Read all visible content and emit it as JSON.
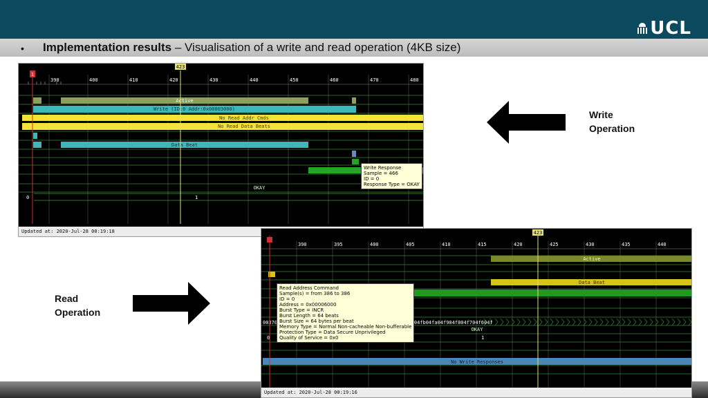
{
  "header": {
    "logo_text": "UCL",
    "title_bold": "Implementation results",
    "title_rest": " – Visualisation of a write and read operation (4KB size)",
    "bullet": "•",
    "colors": {
      "band": "#0b4a5e",
      "title_bar": "#c8c8c8"
    }
  },
  "labels": {
    "write_line1": "Write",
    "write_line2": "Operation",
    "read_line1": "Read",
    "read_line2": "Operation"
  },
  "icons": {
    "write_arrow": "arrow-left-icon",
    "read_arrow": "arrow-right-icon"
  },
  "write_panel": {
    "cursor_label": "423",
    "ticks": [
      "390",
      "400",
      "410",
      "420",
      "430",
      "440",
      "450",
      "460",
      "470",
      "480"
    ],
    "marker": "1",
    "bars": {
      "active": "Active",
      "write": "Write (ID:0 Addr:0x00003000)",
      "no_read_addr": "No Read Addr Cmds",
      "no_read_data": "No Read Data Beats",
      "data_beat": "Data Beat",
      "okay": "OKAY",
      "counter_0": "0",
      "counter_1": "1"
    },
    "tooltip": [
      "Write Response",
      "Sample = 466",
      "ID = 0",
      "Response Type = OKAY"
    ],
    "updated": "Updated at: 2020-Jul-28 00:19:18",
    "colors": {
      "active": "#8e9f5e",
      "write": "#3fb6b8",
      "yellow": "#f2e23a",
      "gridline": "#2f8c2f"
    }
  },
  "read_panel": {
    "cursor_label": "423",
    "ticks": [
      "390",
      "395",
      "400",
      "405",
      "410",
      "415",
      "420",
      "425",
      "430",
      "435",
      "440"
    ],
    "bars": {
      "active": "Active",
      "data_beat": "Data Beat",
      "hex_left": "00370",
      "hex_right": "04fc04fb04fa04f904f804f704f604f",
      "okay": "OKAY",
      "counter_0": "0",
      "counter_1": "1",
      "no_write": "No Write Responses"
    },
    "tooltip": [
      "Read Address Command",
      "Sample(s) = from 386 to 386",
      "ID = 0",
      "Address = 0x00006000",
      "Burst Type = INCR",
      "Burst Length = 64 beats",
      "Burst Size = 64 bytes per beat",
      "Memory Type = Normal Non-cacheable Non-bufferable",
      "Protection Type = Data Secure Unprivileged",
      "Quality of Service = 0x0"
    ],
    "updated": "Updated at: 2020-Jul-28 00:19:16",
    "colors": {
      "active": "#7a8a28",
      "yellow": "#d8c21c",
      "blue": "#4a86b8",
      "green": "#1f9a1f"
    }
  }
}
